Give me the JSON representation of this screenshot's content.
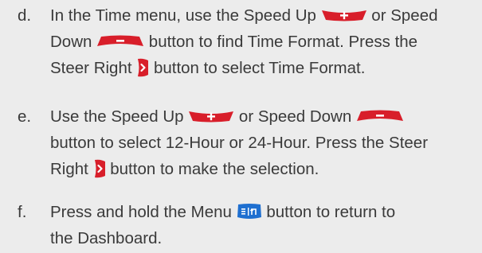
{
  "steps": [
    {
      "letter": "d.",
      "lines": [
        {
          "t1": "In the Time menu, use the Speed Up ",
          "t2": " or Speed"
        },
        {
          "t1": "Down ",
          "t2": " button to find Time Format. Press the"
        },
        {
          "t1": "Steer Right ",
          "t2": " button to select Time Format."
        }
      ]
    },
    {
      "letter": "e.",
      "lines": [
        {
          "t1": "Use the Speed Up ",
          "t2": " or Speed Down "
        },
        {
          "t1": "button to select 12-Hour or 24-Hour. Press the Steer"
        },
        {
          "t1": "Right ",
          "t2": " button to make the selection."
        }
      ]
    },
    {
      "letter": "f.",
      "lines": [
        {
          "t1": "Press and hold the Menu ",
          "t2": " button to return to"
        },
        {
          "t1": "the Dashboard."
        }
      ]
    }
  ],
  "icons": {
    "speed_up": "speed-up-icon",
    "speed_down": "speed-down-icon",
    "steer_right": "steer-right-icon",
    "menu": "menu-icon"
  },
  "colors": {
    "text": "#3a3a3a",
    "background": "#ececec",
    "button_red": "#d81e2a",
    "menu_blue": "#1e6fd0"
  }
}
